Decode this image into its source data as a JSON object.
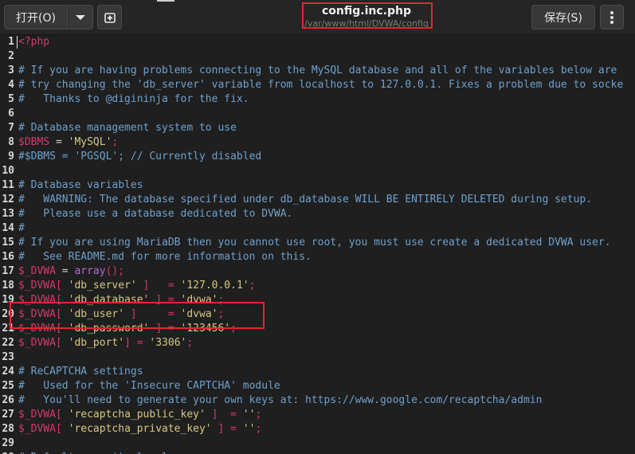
{
  "toolbar": {
    "open_label": "打开(O)",
    "save_label": "保存(S)"
  },
  "window": {
    "title": "config.inc.php",
    "subtitle": "/var/www/html/DVWA/config"
  },
  "code_lines": [
    {
      "n": "1",
      "seg": [
        {
          "t": "<",
          "c": "php"
        },
        {
          "t": "?php",
          "c": "php"
        }
      ]
    },
    {
      "n": "2",
      "seg": []
    },
    {
      "n": "3",
      "seg": [
        {
          "t": "# If you are having problems connecting to the MySQL database and all of the variables below are",
          "c": "c"
        }
      ]
    },
    {
      "n": "4",
      "seg": [
        {
          "t": "# try changing the 'db_server' variable from localhost to 127.0.0.1. Fixes a problem due to socke",
          "c": "c"
        }
      ]
    },
    {
      "n": "5",
      "seg": [
        {
          "t": "#   Thanks to @digininja for the fix.",
          "c": "c"
        }
      ]
    },
    {
      "n": "6",
      "seg": []
    },
    {
      "n": "7",
      "seg": [
        {
          "t": "# Database management system to use",
          "c": "c"
        }
      ]
    },
    {
      "n": "8",
      "seg": [
        {
          "t": "$DBMS",
          "c": "var"
        },
        {
          "t": " = ",
          "c": "txt"
        },
        {
          "t": "'MySQL'",
          "c": "str"
        },
        {
          "t": ";",
          "c": "var"
        }
      ]
    },
    {
      "n": "9",
      "seg": [
        {
          "t": "#$DBMS = 'PGSQL'; // Currently disabled",
          "c": "c"
        }
      ]
    },
    {
      "n": "10",
      "seg": []
    },
    {
      "n": "11",
      "seg": [
        {
          "t": "# Database variables",
          "c": "c"
        }
      ]
    },
    {
      "n": "12",
      "seg": [
        {
          "t": "#   WARNING: The database specified under db_database WILL BE ENTIRELY DELETED during setup.",
          "c": "c"
        }
      ]
    },
    {
      "n": "13",
      "seg": [
        {
          "t": "#   Please use a database dedicated to DVWA.",
          "c": "c"
        }
      ]
    },
    {
      "n": "14",
      "seg": [
        {
          "t": "#",
          "c": "c"
        }
      ]
    },
    {
      "n": "15",
      "seg": [
        {
          "t": "# If you are using MariaDB then you cannot use root, you must use create a dedicated DVWA user.",
          "c": "c"
        }
      ]
    },
    {
      "n": "16",
      "seg": [
        {
          "t": "#   See README.md for more information on this.",
          "c": "c"
        }
      ]
    },
    {
      "n": "17",
      "seg": [
        {
          "t": "$_DVWA",
          "c": "var"
        },
        {
          "t": " = ",
          "c": "txt"
        },
        {
          "t": "array",
          "c": "kw"
        },
        {
          "t": "();",
          "c": "var"
        }
      ]
    },
    {
      "n": "18",
      "seg": [
        {
          "t": "$_DVWA",
          "c": "var"
        },
        {
          "t": "[ ",
          "c": "var"
        },
        {
          "t": "'db_server'",
          "c": "str"
        },
        {
          "t": " ]   = ",
          "c": "var"
        },
        {
          "t": "'127.0.0.1'",
          "c": "str"
        },
        {
          "t": ";",
          "c": "var"
        }
      ]
    },
    {
      "n": "19",
      "seg": [
        {
          "t": "$_DVWA",
          "c": "var"
        },
        {
          "t": "[ ",
          "c": "var"
        },
        {
          "t": "'db_database'",
          "c": "str"
        },
        {
          "t": " ] = ",
          "c": "var"
        },
        {
          "t": "'dvwa'",
          "c": "str"
        },
        {
          "t": ";",
          "c": "var"
        }
      ]
    },
    {
      "n": "20",
      "seg": [
        {
          "t": "$_DVWA",
          "c": "var"
        },
        {
          "t": "[ ",
          "c": "var"
        },
        {
          "t": "'db_user'",
          "c": "str"
        },
        {
          "t": " ]     = ",
          "c": "var"
        },
        {
          "t": "'dvwa'",
          "c": "str"
        },
        {
          "t": ";",
          "c": "var"
        }
      ]
    },
    {
      "n": "21",
      "seg": [
        {
          "t": "$_DVWA",
          "c": "var"
        },
        {
          "t": "[ ",
          "c": "var"
        },
        {
          "t": "'db_password'",
          "c": "str"
        },
        {
          "t": " ] = ",
          "c": "var"
        },
        {
          "t": "'123456'",
          "c": "str"
        },
        {
          "t": ";",
          "c": "var"
        }
      ]
    },
    {
      "n": "22",
      "seg": [
        {
          "t": "$_DVWA",
          "c": "var"
        },
        {
          "t": "[ ",
          "c": "var"
        },
        {
          "t": "'db_port'",
          "c": "str"
        },
        {
          "t": "] = ",
          "c": "var"
        },
        {
          "t": "'3306'",
          "c": "str"
        },
        {
          "t": ";",
          "c": "var"
        }
      ]
    },
    {
      "n": "23",
      "seg": []
    },
    {
      "n": "24",
      "seg": [
        {
          "t": "# ReCAPTCHA settings",
          "c": "c"
        }
      ]
    },
    {
      "n": "25",
      "seg": [
        {
          "t": "#   Used for the 'Insecure CAPTCHA' module",
          "c": "c"
        }
      ]
    },
    {
      "n": "26",
      "seg": [
        {
          "t": "#   You'll need to generate your own keys at: https://www.google.com/recaptcha/admin",
          "c": "c"
        }
      ]
    },
    {
      "n": "27",
      "seg": [
        {
          "t": "$_DVWA",
          "c": "var"
        },
        {
          "t": "[ ",
          "c": "var"
        },
        {
          "t": "'recaptcha_public_key'",
          "c": "str"
        },
        {
          "t": " ]  = ",
          "c": "var"
        },
        {
          "t": "''",
          "c": "str"
        },
        {
          "t": ";",
          "c": "var"
        }
      ]
    },
    {
      "n": "28",
      "seg": [
        {
          "t": "$_DVWA",
          "c": "var"
        },
        {
          "t": "[ ",
          "c": "var"
        },
        {
          "t": "'recaptcha_private_key'",
          "c": "str"
        },
        {
          "t": " ] = ",
          "c": "var"
        },
        {
          "t": "''",
          "c": "str"
        },
        {
          "t": ";",
          "c": "var"
        }
      ]
    },
    {
      "n": "29",
      "seg": []
    },
    {
      "n": "30",
      "seg": [
        {
          "t": "# Default security level",
          "c": "c"
        }
      ]
    }
  ]
}
